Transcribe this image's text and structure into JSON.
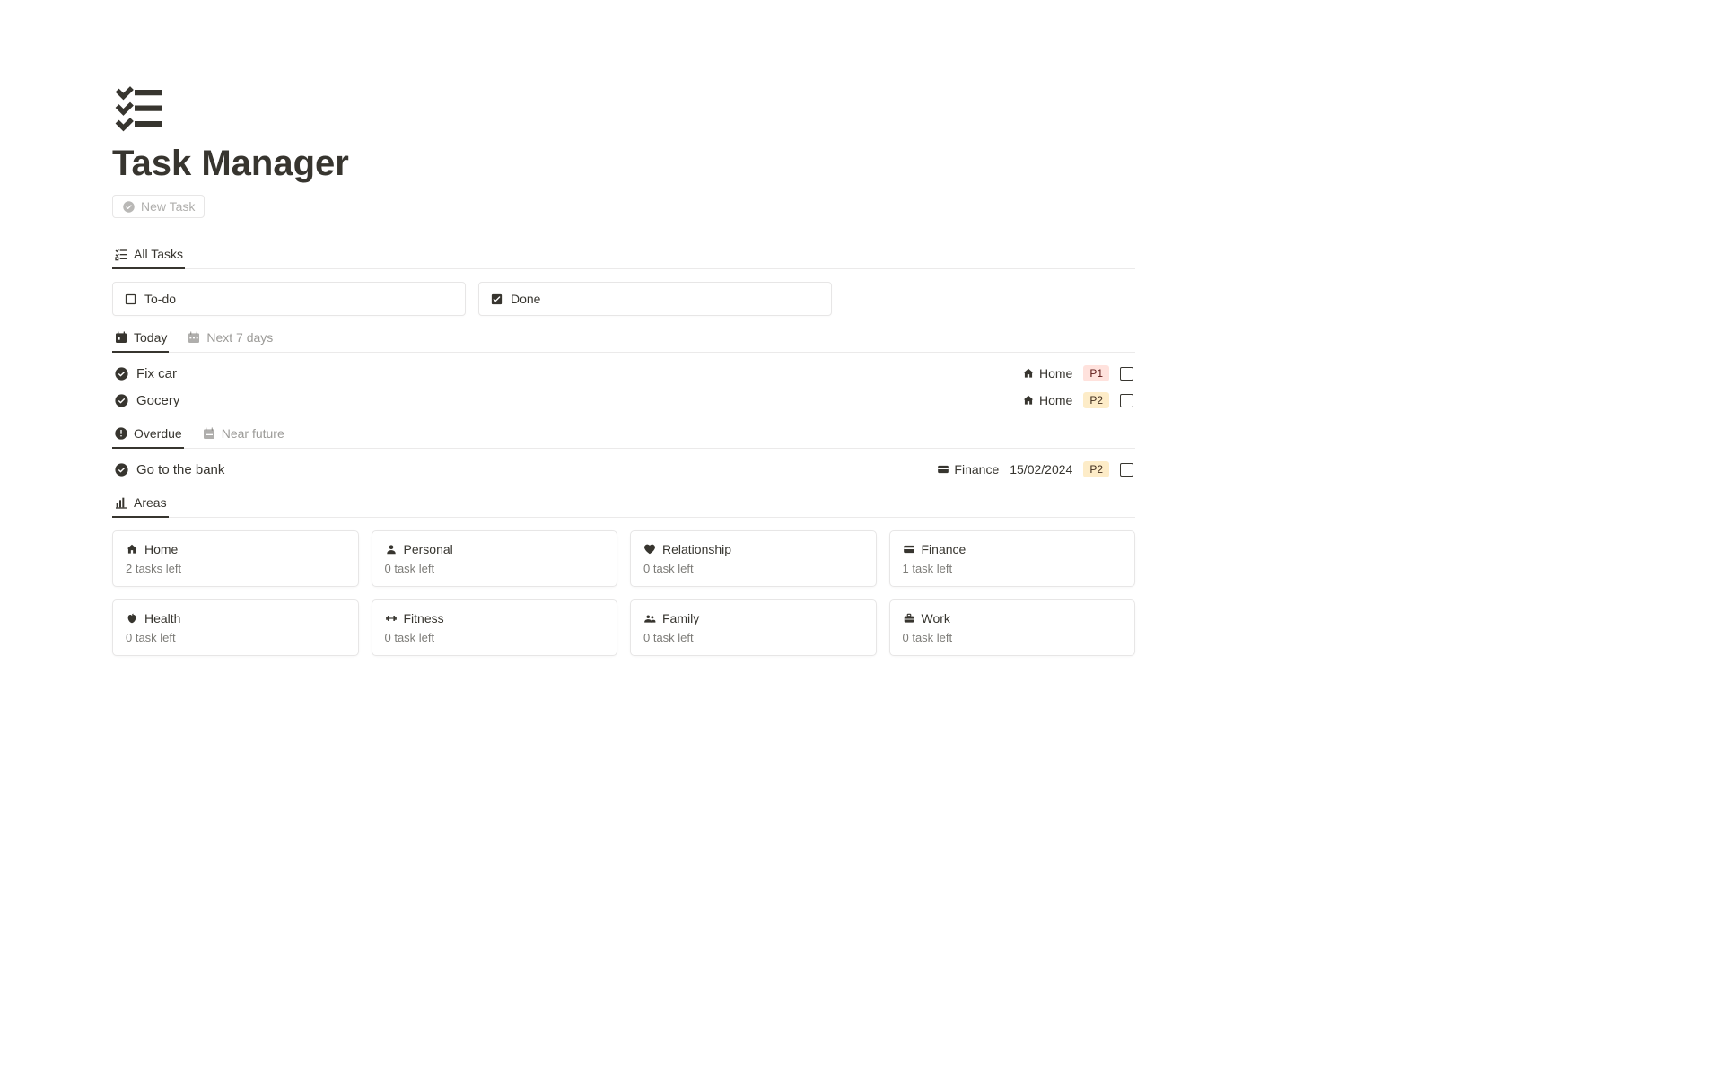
{
  "page": {
    "title": "Task Manager"
  },
  "new_task_button": "New Task",
  "view_tabs": {
    "all_tasks": "All Tasks"
  },
  "status_groups": {
    "todo": "To-do",
    "done": "Done"
  },
  "today_tabs": {
    "today": "Today",
    "next7": "Next 7 days"
  },
  "today_tasks": [
    {
      "title": "Fix car",
      "area": "Home",
      "area_icon": "home",
      "priority": "P1",
      "checked": false
    },
    {
      "title": "Gocery",
      "area": "Home",
      "area_icon": "home",
      "priority": "P2",
      "checked": false
    }
  ],
  "overdue_tabs": {
    "overdue": "Overdue",
    "near_future": "Near future"
  },
  "overdue_tasks": [
    {
      "title": "Go to the bank",
      "area": "Finance",
      "area_icon": "card",
      "date": "15/02/2024",
      "priority": "P2",
      "checked": false
    }
  ],
  "areas_tab": "Areas",
  "areas": [
    {
      "icon": "home",
      "name": "Home",
      "sub": "2 tasks left"
    },
    {
      "icon": "person",
      "name": "Personal",
      "sub": "0 task left"
    },
    {
      "icon": "heart",
      "name": "Relationship",
      "sub": "0 task left"
    },
    {
      "icon": "card",
      "name": "Finance",
      "sub": "1 task left"
    },
    {
      "icon": "apple",
      "name": "Health",
      "sub": "0 task left"
    },
    {
      "icon": "dumbbell",
      "name": "Fitness",
      "sub": "0 task left"
    },
    {
      "icon": "group",
      "name": "Family",
      "sub": "0 task left"
    },
    {
      "icon": "briefcase",
      "name": "Work",
      "sub": "0 task left"
    }
  ]
}
